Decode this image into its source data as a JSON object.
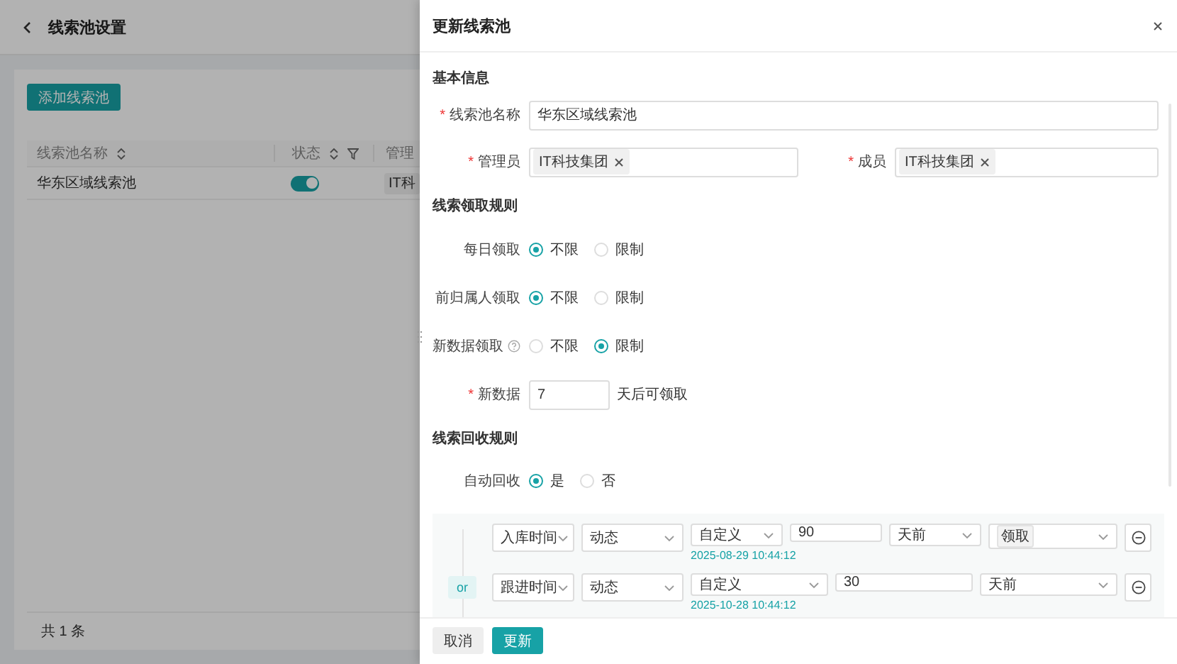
{
  "page": {
    "title": "线索池设置",
    "add_button": "添加线索池",
    "table": {
      "columns": [
        {
          "label": "线索池名称",
          "sortable": true,
          "filterable": false
        },
        {
          "label": "状态",
          "sortable": true,
          "filterable": true
        },
        {
          "label": "管理"
        }
      ],
      "rows": [
        {
          "name": "华东区域线索池",
          "status_on": true,
          "admin_tag": "IT科"
        }
      ]
    },
    "total": "共 1 条"
  },
  "drawer": {
    "title": "更新线索池",
    "required_mark": "*",
    "basic": {
      "title": "基本信息",
      "name_field": {
        "label": "线索池名称",
        "required": true,
        "value": "华东区域线索池"
      },
      "tag_fields": [
        {
          "label": "管理员",
          "required": true,
          "tags": [
            "IT科技集团"
          ]
        },
        {
          "label": "成员",
          "required": true,
          "tags": [
            "IT科技集团"
          ]
        }
      ]
    },
    "claim": {
      "title": "线索领取规则",
      "radio_groups": [
        {
          "label": "每日领取",
          "help": false,
          "options": [
            {
              "label": "不限",
              "selected": true
            },
            {
              "label": "限制",
              "selected": false
            }
          ]
        },
        {
          "label": "前归属人领取",
          "help": false,
          "options": [
            {
              "label": "不限",
              "selected": true
            },
            {
              "label": "限制",
              "selected": false
            }
          ]
        },
        {
          "label": "新数据领取",
          "help": true,
          "options": [
            {
              "label": "不限",
              "selected": false
            },
            {
              "label": "限制",
              "selected": true
            }
          ]
        }
      ],
      "new_data": {
        "label": "新数据",
        "required": true,
        "value": "7",
        "suffix": "天后可领取"
      }
    },
    "recycle": {
      "title": "线索回收规则",
      "radio_groups": [
        {
          "label": "自动回收",
          "help": false,
          "options": [
            {
              "label": "是",
              "selected": true
            },
            {
              "label": "否",
              "selected": false
            }
          ]
        }
      ]
    },
    "conditions": {
      "connector": "or",
      "rows": [
        {
          "cells": [
            {
              "kind": "select",
              "value": "入库时间"
            },
            {
              "kind": "select",
              "value": "动态"
            },
            {
              "kind": "select",
              "value": "自定义",
              "hint": "2025-08-29 10:44:12"
            },
            {
              "kind": "input",
              "value": "90"
            },
            {
              "kind": "select",
              "value": "天前"
            },
            {
              "kind": "tag-select",
              "tags": [
                "领取"
              ]
            }
          ]
        },
        {
          "cells": [
            {
              "kind": "select",
              "value": "跟进时间"
            },
            {
              "kind": "select",
              "value": "动态"
            },
            {
              "kind": "select",
              "value": "自定义",
              "hint": "2025-10-28 10:44:12"
            },
            {
              "kind": "input",
              "value": "30"
            },
            {
              "kind": "select",
              "value": "天前"
            }
          ]
        }
      ]
    },
    "buttons": [
      {
        "kind": "default",
        "label": "取消"
      },
      {
        "kind": "primary",
        "label": "更新"
      }
    ]
  }
}
